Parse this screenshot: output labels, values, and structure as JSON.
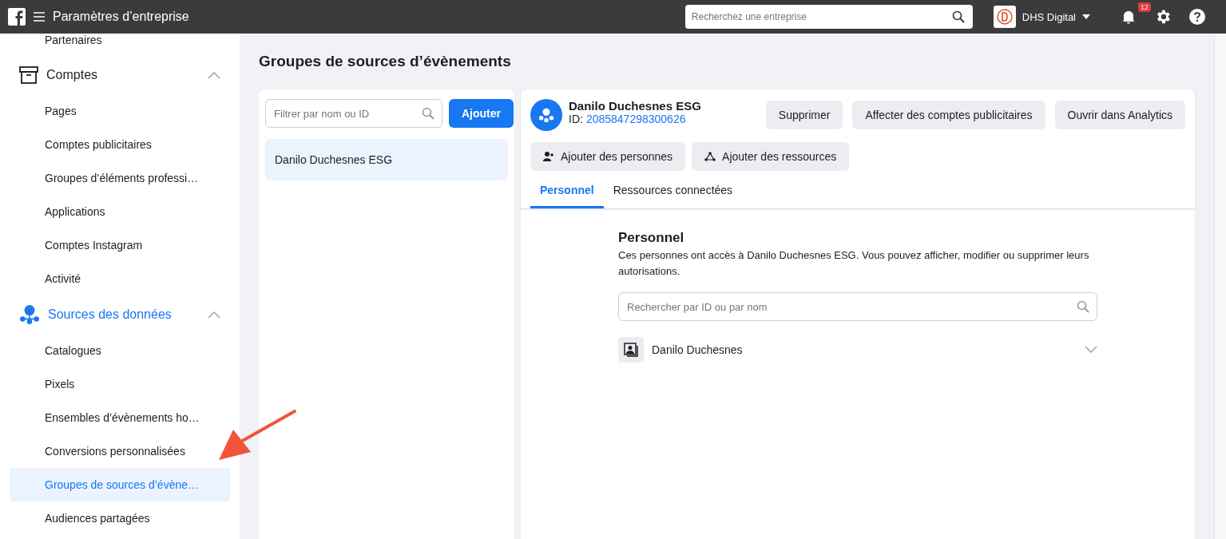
{
  "header": {
    "title": "Paramètres d’entreprise",
    "search": {
      "placeholder": "Recherchez une entreprise"
    },
    "account": {
      "name": "DHS Digital"
    },
    "notifications": {
      "count": "12"
    }
  },
  "sidebar": {
    "items": [
      {
        "label": "Partenaires",
        "selected": false
      }
    ],
    "sections": [
      {
        "kind": "accounts",
        "label": "Comptes",
        "active": false,
        "expanded": true,
        "children": [
          {
            "label": "Pages",
            "selected": false
          },
          {
            "label": "Comptes publicitaires",
            "selected": false
          },
          {
            "label": "Groupes d’éléments professi…",
            "selected": false
          },
          {
            "label": "Applications",
            "selected": false
          },
          {
            "label": "Comptes Instagram",
            "selected": false
          },
          {
            "label": "Activité",
            "selected": false
          }
        ]
      },
      {
        "kind": "data",
        "label": "Sources des données",
        "active": true,
        "expanded": true,
        "children": [
          {
            "label": "Catalogues",
            "selected": false
          },
          {
            "label": "Pixels",
            "selected": false
          },
          {
            "label": "Ensembles d’évènements ho…",
            "selected": false
          },
          {
            "label": "Conversions personnalisées",
            "selected": false
          },
          {
            "label": "Groupes de sources d’évène…",
            "selected": true
          },
          {
            "label": "Audiences partagées",
            "selected": false
          }
        ]
      }
    ]
  },
  "page": {
    "title": "Groupes de sources d’évènements"
  },
  "list_panel": {
    "filter": {
      "placeholder": "Filtrer par nom ou ID"
    },
    "add_button": "Ajouter",
    "items": [
      {
        "label": "Danilo Duchesnes ESG",
        "selected": true
      }
    ]
  },
  "detail": {
    "name": "Danilo Duchesnes ESG",
    "id_label": "ID:",
    "id": "2085847298300626",
    "actions": [
      "Supprimer",
      "Affecter des comptes publicitaires",
      "Ouvrir dans Analytics"
    ],
    "secondary_actions": [
      {
        "kind": "people",
        "label": "Ajouter des personnes"
      },
      {
        "kind": "assets",
        "label": "Ajouter des ressources"
      }
    ],
    "tabs": [
      {
        "label": "Personnel",
        "selected": true
      },
      {
        "label": "Ressources connectées",
        "selected": false
      }
    ],
    "section": {
      "title": "Personnel",
      "description": "Ces personnes ont accès à Danilo Duchesnes ESG. Vous pouvez afficher, modifier ou supprimer leurs autorisations.",
      "search": {
        "placeholder": "Rechercher par ID ou par nom"
      },
      "people": [
        {
          "name": "Danilo Duchesnes",
          "expanded": false
        }
      ]
    }
  }
}
